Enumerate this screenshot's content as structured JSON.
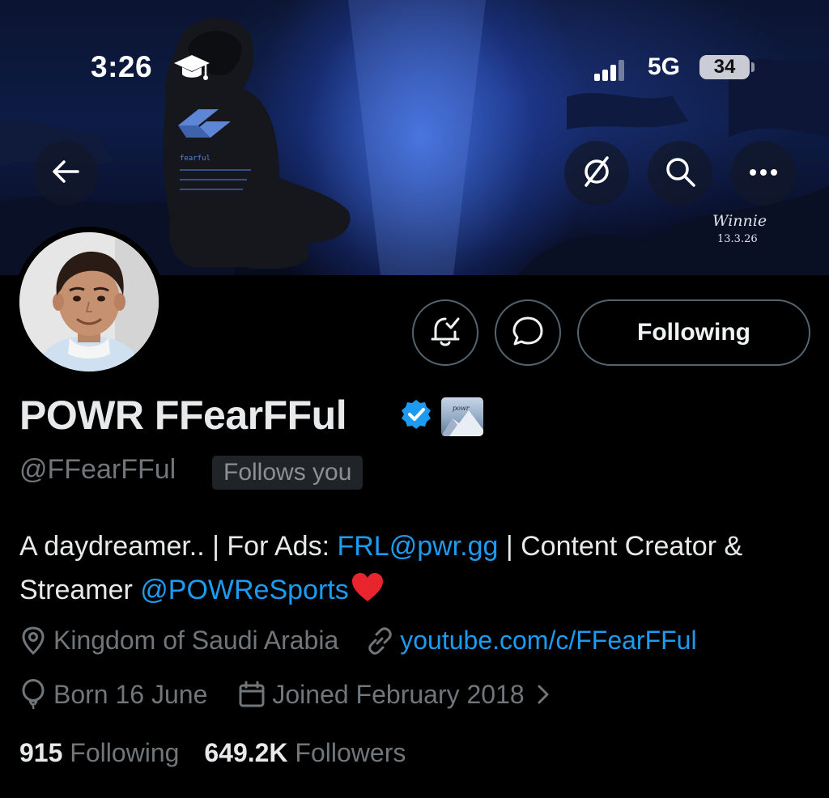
{
  "status_bar": {
    "time": "3:26",
    "network": "5G",
    "battery": "34"
  },
  "banner": {
    "signature": "Winnie",
    "signature_date": "13.3.26"
  },
  "profile": {
    "display_name": "POWR FFearFFul",
    "handle": "@FFearFFul",
    "follows_you": "Follows you",
    "bio": {
      "part1": "A daydreamer.. | For Ads: ",
      "email": "FRL@pwr.gg",
      "part2": " | Content Creator & Streamer ",
      "mention": "@POWReSports"
    },
    "location": "Kingdom of Saudi Arabia",
    "website": "youtube.com/c/FFearFFul",
    "birthday": "Born 16 June",
    "joined": "Joined February 2018",
    "following_count": "915",
    "following_label": "Following",
    "followers_count": "649.2K",
    "followers_label": "Followers"
  },
  "actions": {
    "following_button": "Following"
  },
  "icons": {
    "back": "arrow-left-icon",
    "grok": "grok-icon",
    "search": "search-icon",
    "more": "more-icon",
    "notify": "bell-check-icon",
    "message": "message-icon",
    "verified": "verified-badge-icon",
    "location": "location-pin-icon",
    "link": "link-icon",
    "birthday": "balloon-icon",
    "calendar": "calendar-icon",
    "chevron": "chevron-right-icon"
  },
  "colors": {
    "accent": "#1d9bf0",
    "muted": "#71767b",
    "background": "#000000",
    "verified": "#1d9bf0"
  }
}
